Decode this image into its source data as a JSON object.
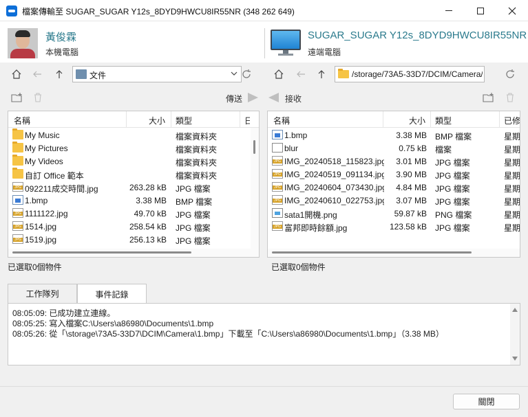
{
  "window": {
    "title": "檔案傳輸至 SUGAR_SUGAR Y12s_8DYD9HWCU8IR55NR (348 262 649)"
  },
  "local": {
    "name": "黃俊霖",
    "subtitle": "本機電腦",
    "path": "文件",
    "status": "已選取0個物件",
    "columns": [
      "名稱",
      "大小",
      "類型",
      "日"
    ],
    "files": [
      {
        "icon": "folder-icon",
        "name": "My Music",
        "size": "",
        "type": "檔案資料夾"
      },
      {
        "icon": "folder-icon",
        "name": "My Pictures",
        "size": "",
        "type": "檔案資料夾"
      },
      {
        "icon": "folder-icon",
        "name": "My Videos",
        "size": "",
        "type": "檔案資料夾"
      },
      {
        "icon": "folder-icon",
        "name": "自訂 Office 範本",
        "size": "",
        "type": "檔案資料夾"
      },
      {
        "icon": "jpg-file-icon",
        "name": "092211成交時間.jpg",
        "size": "263.28 kB",
        "type": "JPG 檔案"
      },
      {
        "icon": "bmp-file-icon",
        "name": "1.bmp",
        "size": "3.38 MB",
        "type": "BMP 檔案"
      },
      {
        "icon": "jpg-file-icon",
        "name": "1111122.jpg",
        "size": "49.70 kB",
        "type": "JPG 檔案"
      },
      {
        "icon": "jpg-file-icon",
        "name": "1514.jpg",
        "size": "258.54 kB",
        "type": "JPG 檔案"
      },
      {
        "icon": "jpg-file-icon",
        "name": "1519.jpg",
        "size": "256.13 kB",
        "type": "JPG 檔案"
      }
    ]
  },
  "remote": {
    "name": "SUGAR_SUGAR Y12s_8DYD9HWCU8IR55NR",
    "subtitle": "遠端電腦",
    "path": "/storage/73A5-33D7/DCIM/Camera/",
    "status": "已選取0個物件",
    "columns": [
      "名稱",
      "大小",
      "類型",
      "已修"
    ],
    "files": [
      {
        "icon": "bmp-file-icon",
        "name": "1.bmp",
        "size": "3.38 MB",
        "type": "BMP 檔案",
        "date": "星期"
      },
      {
        "icon": "blank-file-icon",
        "name": "blur",
        "size": "0.75 kB",
        "type": "檔案",
        "date": "星期"
      },
      {
        "icon": "jpg-file-icon",
        "name": "IMG_20240518_115823.jpg",
        "size": "3.01 MB",
        "type": "JPG 檔案",
        "date": "星期"
      },
      {
        "icon": "jpg-file-icon",
        "name": "IMG_20240519_091134.jpg",
        "size": "3.90 MB",
        "type": "JPG 檔案",
        "date": "星期"
      },
      {
        "icon": "jpg-file-icon",
        "name": "IMG_20240604_073430.jpg",
        "size": "4.84 MB",
        "type": "JPG 檔案",
        "date": "星期"
      },
      {
        "icon": "jpg-file-icon",
        "name": "IMG_20240610_022753.jpg",
        "size": "3.07 MB",
        "type": "JPG 檔案",
        "date": "星期"
      },
      {
        "icon": "png-file-icon",
        "name": "sata1開機.png",
        "size": "59.87 kB",
        "type": "PNG 檔案",
        "date": "星期"
      },
      {
        "icon": "jpg-file-icon",
        "name": "富邦即時餘額.jpg",
        "size": "123.58 kB",
        "type": "JPG 檔案",
        "date": "星期"
      }
    ]
  },
  "actions": {
    "send": "傳送",
    "receive": "接收"
  },
  "tabs": [
    {
      "label": "工作隊列"
    },
    {
      "label": "事件記錄"
    }
  ],
  "log": [
    "08:05:09: 已成功建立連線。",
    "08:05:25: 寫入檔案C:\\Users\\a86980\\Documents\\1.bmp",
    "08:05:26: 從「\\storage\\73A5-33D7\\DCIM\\Camera\\1.bmp」下載至「C:\\Users\\a86980\\Documents\\1.bmp」（3.38 MB）"
  ],
  "footer": {
    "close_label": "關閉"
  }
}
